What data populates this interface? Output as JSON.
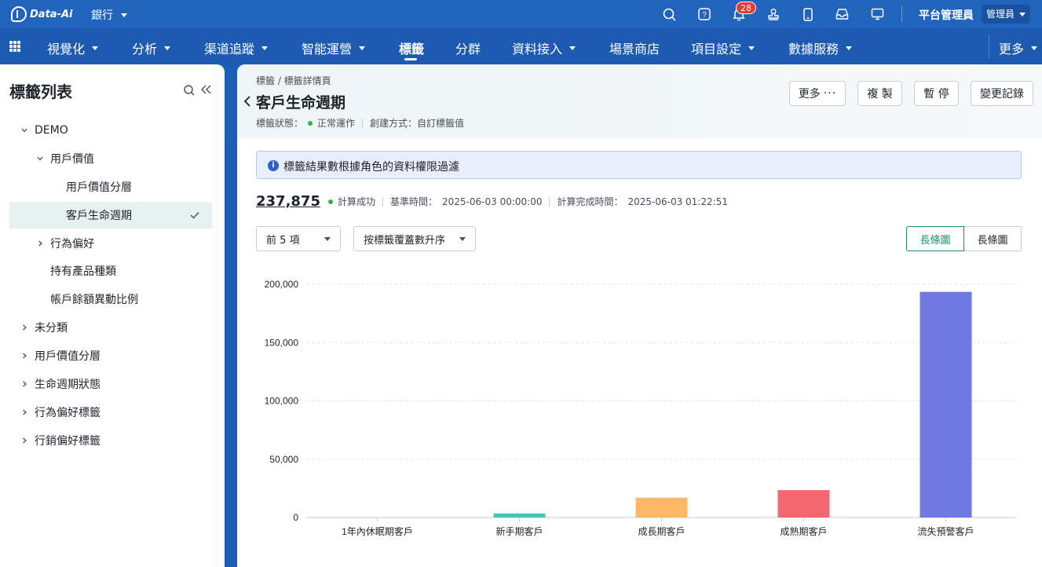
{
  "topbar": {
    "logo_text": "Data-Ai",
    "workspace": "銀行",
    "notification_count": "28",
    "user_name": "平台管理員",
    "role": "管理員"
  },
  "nav": {
    "items": [
      {
        "label": "視覺化",
        "dropdown": true
      },
      {
        "label": "分析",
        "dropdown": true
      },
      {
        "label": "渠道追蹤",
        "dropdown": true
      },
      {
        "label": "智能運營",
        "dropdown": true
      },
      {
        "label": "標籤",
        "dropdown": false,
        "active": true
      },
      {
        "label": "分群",
        "dropdown": false
      },
      {
        "label": "資料接入",
        "dropdown": true
      },
      {
        "label": "場景商店",
        "dropdown": false
      },
      {
        "label": "項目設定",
        "dropdown": true
      },
      {
        "label": "數據服務",
        "dropdown": true
      }
    ],
    "more": "更多"
  },
  "sidebar": {
    "title": "標籤列表",
    "tree": [
      {
        "label": "DEMO",
        "expanded": true
      },
      {
        "label": "用戶價值",
        "expanded": true
      },
      {
        "label": "用戶價值分層"
      },
      {
        "label": "客戶生命週期",
        "selected": true
      },
      {
        "label": "行為偏好",
        "expanded": false
      },
      {
        "label": "持有產品種類"
      },
      {
        "label": "帳戶餘額異動比例"
      },
      {
        "label": "未分類",
        "expanded": false
      },
      {
        "label": "用戶價值分層",
        "expanded": false
      },
      {
        "label": "生命週期狀態",
        "expanded": false
      },
      {
        "label": "行為偏好標籤",
        "expanded": false
      },
      {
        "label": "行銷偏好標籤",
        "expanded": false
      }
    ]
  },
  "header": {
    "breadcrumb": "標籤 / 標籤詳情頁",
    "title": "客戶生命週期",
    "status_label": "標籤狀態：",
    "status_value": "正常運作",
    "create_label": "創建方式：自訂標籤值",
    "buttons": {
      "more": "更多",
      "copy": "複 製",
      "pause": "暫 停",
      "history": "變更記錄"
    }
  },
  "info_banner": "標籤結果數根據角色的資料權限過濾",
  "stats": {
    "count": "237,875",
    "calc_status": "計算成功",
    "base_time_label": "基準時間：",
    "base_time": "2025-06-03 00:00:00",
    "finish_time_label": "計算完成時間：",
    "finish_time": "2025-06-03 01:22:51"
  },
  "controls": {
    "top_n": "前 5 項",
    "sort": "按標籤覆蓋數升序",
    "view_active": "長條圖",
    "view_other": "長條圖"
  },
  "colors": {
    "primary": "#2064bd",
    "accent_green": "#1e8c6e",
    "status_ok": "#2fb344"
  },
  "chart_data": {
    "type": "bar",
    "categories": [
      "1年內休眠期客戶",
      "新手期客戶",
      "成長期客戶",
      "成熟期客戶",
      "流失預警客戶"
    ],
    "values": [
      200,
      3500,
      17000,
      23500,
      193500
    ],
    "colors": [
      "#cfcfcf",
      "#3ec9b6",
      "#fdb867",
      "#f5676e",
      "#7079e0"
    ],
    "ylim": [
      0,
      200000
    ],
    "yticks": [
      0,
      50000,
      100000,
      150000,
      200000
    ],
    "ytick_labels": [
      "0",
      "50,000",
      "100,000",
      "150,000",
      "200,000"
    ],
    "grid": true,
    "title": "",
    "xlabel": "",
    "ylabel": ""
  }
}
